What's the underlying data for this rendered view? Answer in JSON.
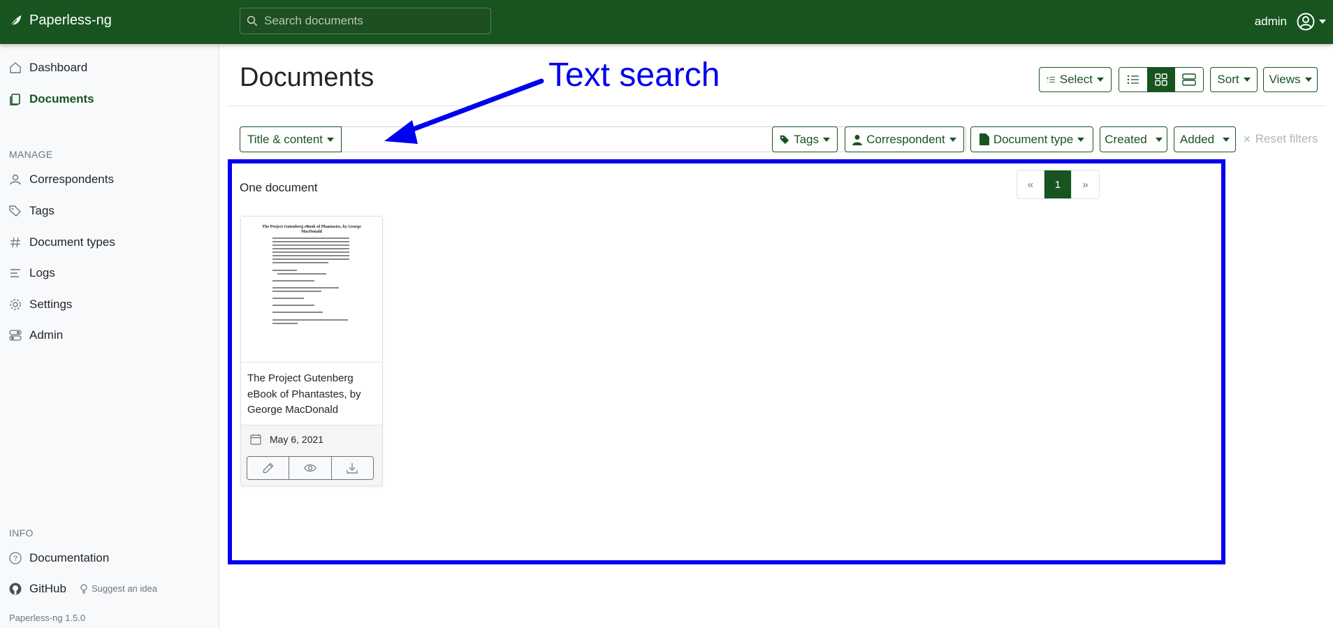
{
  "app": {
    "name": "Paperless-ng",
    "version": "Paperless-ng 1.5.0"
  },
  "topbar": {
    "search_placeholder": "Search documents",
    "username": "admin"
  },
  "sidebar": {
    "items": [
      {
        "label": "Dashboard",
        "icon": "house-icon"
      },
      {
        "label": "Documents",
        "icon": "documents-icon",
        "active": true
      }
    ],
    "manage_label": "MANAGE",
    "manage_items": [
      {
        "label": "Correspondents",
        "icon": "person-icon"
      },
      {
        "label": "Tags",
        "icon": "tags-icon"
      },
      {
        "label": "Document types",
        "icon": "hash-icon"
      },
      {
        "label": "Logs",
        "icon": "text-lines-icon"
      },
      {
        "label": "Settings",
        "icon": "gear-icon"
      },
      {
        "label": "Admin",
        "icon": "toggles-icon"
      }
    ],
    "info_label": "INFO",
    "info_items": [
      {
        "label": "Documentation",
        "icon": "question-circle-icon"
      },
      {
        "label": "GitHub",
        "icon": "github-icon"
      }
    ],
    "suggest": "Suggest an idea"
  },
  "main": {
    "title": "Documents",
    "toolbar": {
      "select": "Select",
      "sort": "Sort",
      "views": "Views"
    },
    "filters": {
      "scope": "Title & content",
      "query": "",
      "tags": "Tags",
      "correspondent": "Correspondent",
      "document_type": "Document type",
      "created": "Created",
      "added": "Added",
      "reset": "Reset filters"
    },
    "count": "One document",
    "pagination": {
      "prev": "«",
      "current": "1",
      "next": "»"
    },
    "documents": [
      {
        "title": "The Project Gutenberg eBook of Phantastes, by George MacDonald",
        "date": "May 6, 2021",
        "thumb_heading": "The Project Gutenberg eBook of Phantastes, by George MacDonald"
      }
    ]
  },
  "annotation": {
    "text": "Text search"
  },
  "colors": {
    "brand": "#17541f",
    "annotation": "#0000f0",
    "sidebar_bg": "#f8f9fa"
  }
}
